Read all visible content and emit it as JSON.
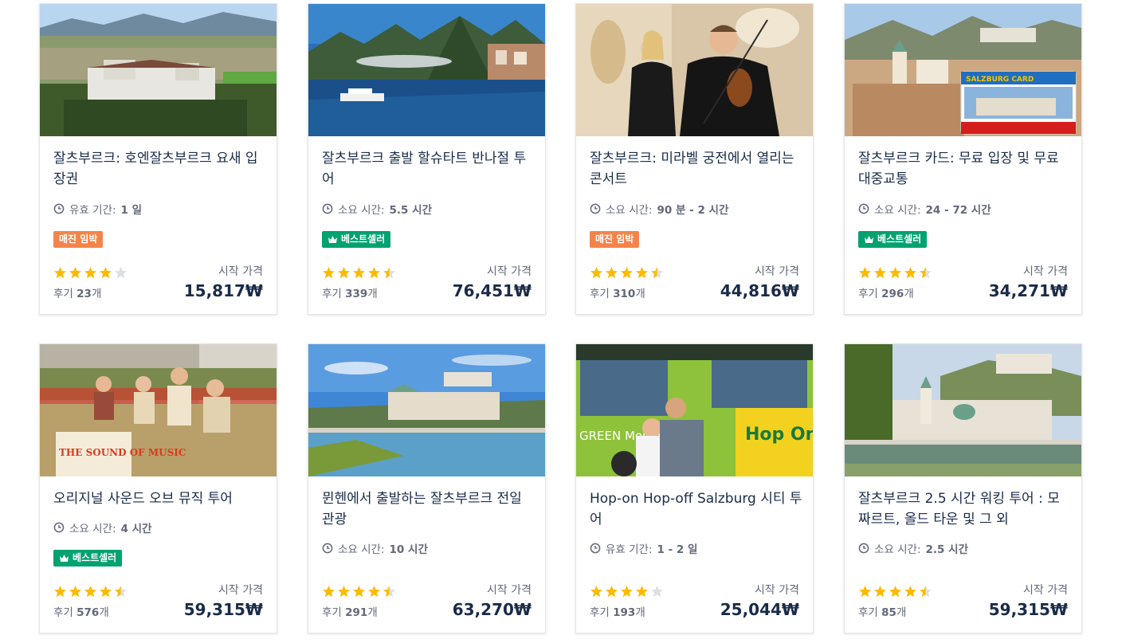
{
  "price_label": "시작 가격",
  "review_label": "후기",
  "review_suffix": "개",
  "colors": {
    "badge_orange": "#f4844a",
    "badge_green": "#00a270",
    "star": "#fcbb00",
    "star_empty": "#dcdfe4"
  },
  "cards": [
    {
      "title": "잘츠부르크: 호엔잘츠부르크 요새 입장권",
      "meta_icon": "clock-icon",
      "meta_label": "유효 기간:",
      "meta_value": "1 일",
      "badge": "매진 임박",
      "badge_type": "orange",
      "rating": 4,
      "reviews": "23",
      "price": "15,817₩"
    },
    {
      "title": "잘츠부르크 출발 할슈타트 반나절 투어",
      "meta_icon": "clock-icon",
      "meta_label": "소요 시간:",
      "meta_value": "5.5 시간",
      "badge": "베스트셀러",
      "badge_type": "green",
      "rating": 4.5,
      "reviews": "339",
      "price": "76,451₩"
    },
    {
      "title": "잘츠부르크: 미라벨 궁전에서 열리는 콘서트",
      "meta_icon": "clock-icon",
      "meta_label": "소요 시간:",
      "meta_value": "90 분 - 2 시간",
      "badge": "매진 임박",
      "badge_type": "orange",
      "rating": 4.5,
      "reviews": "310",
      "price": "44,816₩"
    },
    {
      "title": "잘츠부르크 카드: 무료 입장 및 무료 대중교통",
      "meta_icon": "clock-icon",
      "meta_label": "소요 시간:",
      "meta_value": "24 - 72 시간",
      "badge": "베스트셀러",
      "badge_type": "green",
      "rating": 4.5,
      "reviews": "296",
      "price": "34,271₩"
    },
    {
      "title": "오리지널 사운드 오브 뮤직 투어",
      "meta_icon": "clock-icon",
      "meta_label": "소요 시간:",
      "meta_value": "4 시간",
      "badge": "베스트셀러",
      "badge_type": "green",
      "rating": 4.5,
      "reviews": "576",
      "price": "59,315₩"
    },
    {
      "title": "뮌헨에서 출발하는 잘츠부르크 전일 관광",
      "meta_icon": "clock-icon",
      "meta_label": "소요 시간:",
      "meta_value": "10 시간",
      "badge": "",
      "badge_type": "",
      "rating": 4.5,
      "reviews": "291",
      "price": "63,270₩"
    },
    {
      "title": "Hop-on Hop-off Salzburg 시티 투어",
      "meta_icon": "clock-icon",
      "meta_label": "유효 기간:",
      "meta_value": "1 - 2 일",
      "badge": "",
      "badge_type": "",
      "rating": 4,
      "reviews": "193",
      "price": "25,044₩"
    },
    {
      "title": "잘츠부르크 2.5 시간 워킹 투어 : 모짜르트, 올드 타운 및 그 외",
      "meta_icon": "clock-icon",
      "meta_label": "소요 시간:",
      "meta_value": "2.5 시간",
      "badge": "",
      "badge_type": "",
      "rating": 4.5,
      "reviews": "85",
      "price": "59,315₩"
    }
  ],
  "image_text": {
    "card4": "SALZBURG CARD",
    "card5": "THE SOUND OF MUSIC",
    "card7_bus": "Hop On Hop Off",
    "card7_side": "GREEN Mountains"
  }
}
